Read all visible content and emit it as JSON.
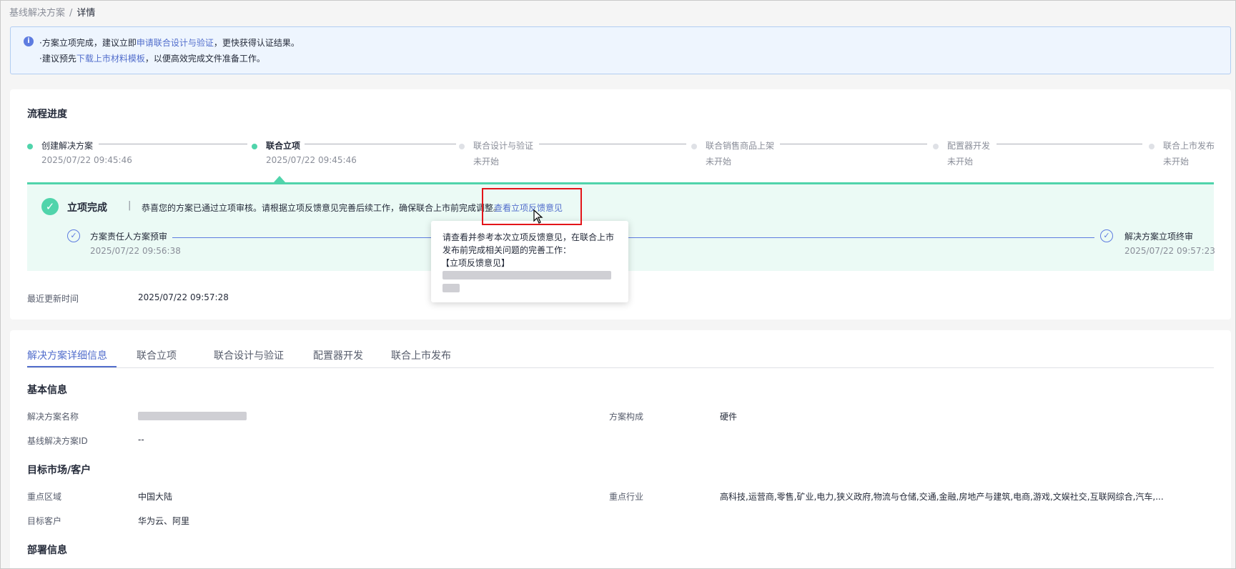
{
  "breadcrumb": {
    "parent": "基线解决方案",
    "separator": "/",
    "current": "详情"
  },
  "notice": {
    "line1_prefix": "·方案立项完成，建议立即",
    "line1_link": "申请联合设计与验证",
    "line1_suffix": "，更快获得认证结果。",
    "line2_prefix": "·建议预先",
    "line2_link": "下载上市材料模板",
    "line2_suffix": "，以便高效完成文件准备工作。"
  },
  "process": {
    "title": "流程进度",
    "steps": [
      {
        "name": "创建解决方案",
        "time": "2025/07/22 09:45:46",
        "state": "done"
      },
      {
        "name": "联合立项",
        "time": "2025/07/22 09:45:46",
        "state": "done"
      },
      {
        "name": "联合设计与验证",
        "time": "未开始",
        "state": "todo"
      },
      {
        "name": "联合销售商品上架",
        "time": "未开始",
        "state": "todo"
      },
      {
        "name": "配置器开发",
        "time": "未开始",
        "state": "todo"
      },
      {
        "name": "联合上市发布",
        "time": "未开始",
        "state": "todo"
      }
    ],
    "status": {
      "title": "立项完成",
      "divider": "|",
      "desc": "恭喜您的方案已通过立项审核。请根据立项反馈意见完善后续工作，确保联合上市前完成调整。",
      "link": "查看立项反馈意见",
      "substeps": [
        {
          "name": "方案责任人方案预审",
          "time": "2025/07/22 09:56:38"
        },
        {
          "name": "解决方案立项终审",
          "time": "2025/07/22 09:57:23"
        }
      ]
    },
    "update_label": "最近更新时间",
    "update_value": "2025/07/22 09:57:28"
  },
  "tooltip": {
    "line1": "请查看并参考本次立项反馈意见，在联合上市",
    "line2": "发布前完成相关问题的完善工作：",
    "line3": "【立项反馈意见】"
  },
  "tabs": [
    "解决方案详细信息",
    "联合立项",
    "联合设计与验证",
    "配置器开发",
    "联合上市发布"
  ],
  "details": {
    "basic_title": "基本信息",
    "solution_name_label": "解决方案名称",
    "composition_label": "方案构成",
    "composition_value": "硬件",
    "baseline_id_label": "基线解决方案ID",
    "baseline_id_value": "--",
    "market_title": "目标市场/客户",
    "region_label": "重点区域",
    "region_value": "中国大陆",
    "industry_label": "重点行业",
    "industry_value": "高科技,运营商,零售,矿业,电力,狭义政府,物流与仓储,交通,金融,房地产与建筑,电商,游戏,文娱社交,互联网综合,汽车,...",
    "customer_label": "目标客户",
    "customer_value": "华为云、阿里",
    "deploy_title": "部署信息"
  }
}
